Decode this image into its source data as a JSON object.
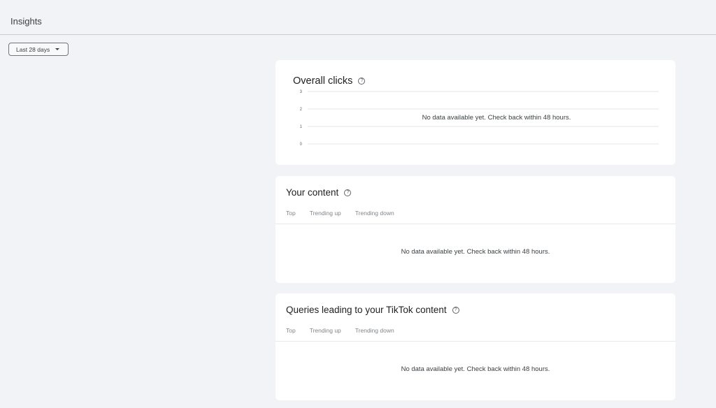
{
  "header": {
    "title": "Insights"
  },
  "filters": {
    "date_range_label": "Last 28 days"
  },
  "overall_clicks": {
    "title": "Overall clicks",
    "empty_message": "No data available yet. Check back within 48 hours."
  },
  "chart_data": {
    "type": "line",
    "title": "Overall clicks",
    "xlabel": "",
    "ylabel": "",
    "ylim": [
      0,
      3
    ],
    "y_ticks": [
      "3",
      "2",
      "1",
      "0"
    ],
    "series": [],
    "grid": true
  },
  "your_content": {
    "title": "Your content",
    "tabs": [
      "Top",
      "Trending up",
      "Trending down"
    ],
    "empty_message": "No data available yet. Check back within 48 hours."
  },
  "queries": {
    "title": "Queries leading to your TikTok content",
    "tabs": [
      "Top",
      "Trending up",
      "Trending down"
    ],
    "empty_message": "No data available yet. Check back within 48 hours."
  },
  "icons": {
    "help": "help-circle-icon",
    "dropdown": "caret-down-icon"
  }
}
